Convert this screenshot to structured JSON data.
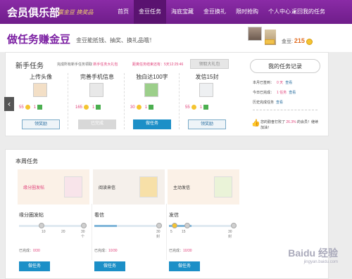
{
  "topbar": {
    "brand": "会员俱乐部",
    "slogan": "赢金豆 换奖品",
    "nav": [
      "首页",
      "金豆任务",
      "海底宝藏",
      "金豆换礼",
      "限时抢购",
      "个人中心"
    ],
    "nav_right": "返回我的任务"
  },
  "header": {
    "title": "做任务赚金豆",
    "tagline": "金豆能抵钱、抽奖、换礼品哦！",
    "coins_label": "金豆:",
    "coins_value": "215"
  },
  "newbie": {
    "title": "新手任务",
    "note_prefix": "完成所有新手任务领取",
    "note_highlight": "新手任务大礼包",
    "countdown": "距离任务结束还有：5天12:25:46",
    "claim_all": "领取大礼包",
    "tasks": [
      {
        "name": "上传头像",
        "coins": "55",
        "gifts": "1",
        "button": "领奖励"
      },
      {
        "name": "完善手机信息",
        "coins": "165",
        "gifts": "1",
        "button": "已完成"
      },
      {
        "name": "独白达100字",
        "coins": "30",
        "gifts": "1",
        "button": "做任务"
      },
      {
        "name": "发信15封",
        "coins": "55",
        "gifts": "1",
        "button": "领奖励"
      }
    ]
  },
  "record": {
    "title": "我的任务记录",
    "rows": [
      {
        "label": "本月已签到：",
        "value": "0 天",
        "link": "查看"
      },
      {
        "label": "今日已完成：",
        "value": "1 任务",
        "link": "查看"
      },
      {
        "label": "历史完成任务",
        "value": "",
        "link": "查看"
      }
    ],
    "footer_prefix": "您的勤奋打败了",
    "footer_pct": "26.3%",
    "footer_suffix": "的会员！继续加油！"
  },
  "weekly": {
    "title": "本周任务",
    "tasks": [
      {
        "banner": "缘分圈发帖",
        "label": "缘分圈发帖",
        "ticks": [
          "10",
          "20",
          "30个"
        ],
        "status_label": "已完成：",
        "status_value": "0/30",
        "button": "做任务",
        "progress": 0.0
      },
      {
        "banner": "阅读来信",
        "label": "看信",
        "ticks": [
          "30封"
        ],
        "status_label": "已完成：",
        "status_value": "10/30",
        "button": "做任务",
        "progress": 0.33
      },
      {
        "banner": "主动发信",
        "label": "发信",
        "ticks": [
          "5",
          "15",
          "30封"
        ],
        "status_label": "已完成：",
        "status_value": "10/30",
        "button": "做任务",
        "progress": 0.33
      }
    ]
  },
  "watermark": {
    "title": "Baidu 经验",
    "sub": "jingyan.baidu.com"
  }
}
